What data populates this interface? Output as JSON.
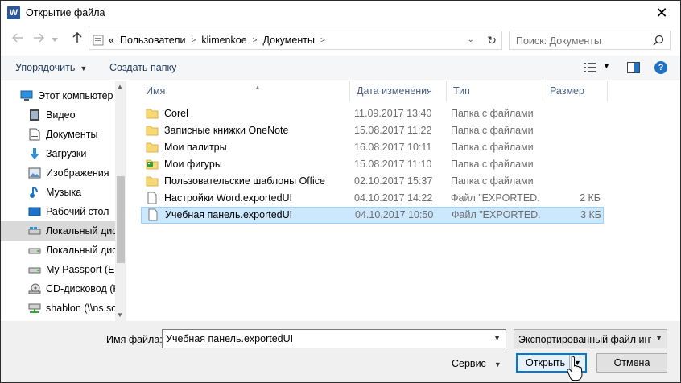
{
  "window": {
    "title": "Открытие файла",
    "app_icon": "W",
    "close": "✕"
  },
  "address": {
    "crumbs": [
      "«",
      "Пользователи",
      "klimenkoe",
      "Документы"
    ],
    "search_placeholder": "Поиск: Документы"
  },
  "toolbar": {
    "organize": "Упорядочить",
    "new_folder": "Создать папку"
  },
  "nav": {
    "items": [
      {
        "label": "Этот компьютер",
        "icon": "computer-icon"
      },
      {
        "label": "Видео",
        "icon": "video-icon"
      },
      {
        "label": "Документы",
        "icon": "documents-icon"
      },
      {
        "label": "Загрузки",
        "icon": "downloads-icon"
      },
      {
        "label": "Изображения",
        "icon": "pictures-icon"
      },
      {
        "label": "Музыка",
        "icon": "music-icon"
      },
      {
        "label": "Рабочий стол",
        "icon": "desktop-icon"
      },
      {
        "label": "Локальный дис",
        "icon": "local-disk-icon",
        "selected": true
      },
      {
        "label": "Локальный дис",
        "icon": "local-disk-icon"
      },
      {
        "label": "My Passport (E:)",
        "icon": "drive-icon"
      },
      {
        "label": "CD-дисковод (K",
        "icon": "cd-drive-icon"
      },
      {
        "label": "shablon (\\\\ns.sc",
        "icon": "network-drive-icon"
      }
    ]
  },
  "columns": {
    "name": "Имя",
    "date": "Дата изменения",
    "type": "Тип",
    "size": "Размер"
  },
  "files": [
    {
      "name": "Corel",
      "date": "11.09.2017 13:40",
      "type": "Папка с файлами",
      "size": "",
      "icon": "folder-icon"
    },
    {
      "name": "Записные книжки OneNote",
      "date": "15.08.2017 11:22",
      "type": "Папка с файлами",
      "size": "",
      "icon": "folder-icon"
    },
    {
      "name": "Мои палитры",
      "date": "16.08.2017 10:11",
      "type": "Папка с файлами",
      "size": "",
      "icon": "folder-icon"
    },
    {
      "name": "Мои фигуры",
      "date": "15.08.2017 11:10",
      "type": "Папка с файлами",
      "size": "",
      "icon": "shapes-folder-icon"
    },
    {
      "name": "Пользовательские шаблоны Office",
      "date": "02.10.2017 15:37",
      "type": "Папка с файлами",
      "size": "",
      "icon": "folder-icon"
    },
    {
      "name": "Настройки Word.exportedUI",
      "date": "04.10.2017 14:22",
      "type": "Файл \"EXPORTED...",
      "size": "2 КБ",
      "icon": "file-icon"
    },
    {
      "name": "Учебная панель.exportedUI",
      "date": "04.10.2017 10:50",
      "type": "Файл \"EXPORTED...",
      "size": "3 КБ",
      "icon": "file-icon",
      "selected": true
    }
  ],
  "bottom": {
    "filename_label": "Имя файла:",
    "filename_value": "Учебная панель.exportedUI",
    "filter_value": "Экспортированный файл инте",
    "tools": "Сервис",
    "open": "Открыть",
    "cancel": "Отмена"
  }
}
